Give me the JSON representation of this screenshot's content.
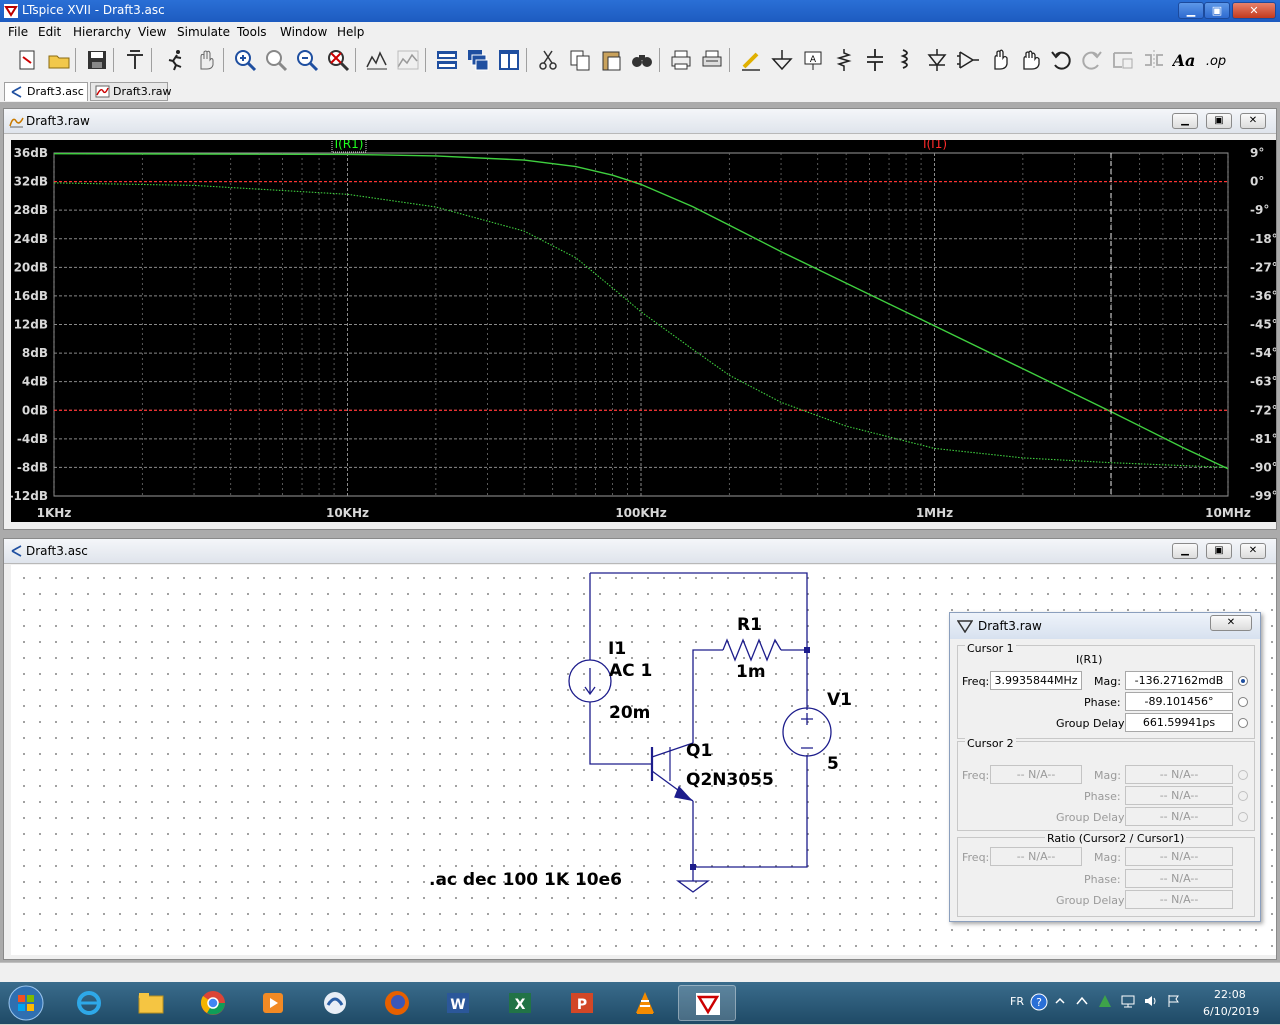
{
  "app": {
    "title": "LTspice XVII - Draft3.asc"
  },
  "menu": [
    "File",
    "Edit",
    "Hierarchy",
    "View",
    "Simulate",
    "Tools",
    "Window",
    "Help"
  ],
  "toolbar_icons": [
    "new-schematic-icon",
    "open-icon",
    "save-icon",
    "control-panel-icon",
    "run-icon",
    "halt-icon",
    "zoom-in-icon",
    "zoom-pan-icon",
    "zoom-out-icon",
    "zoom-fit-icon",
    "autorange-icon",
    "fft-icon",
    "tile-horizontal-icon",
    "cascade-icon",
    "tile-vertical-icon",
    "cut-icon",
    "copy-icon",
    "paste-icon",
    "find-icon",
    "print-icon",
    "print-setup-icon",
    "draw-wire-icon",
    "ground-icon",
    "label-net-icon",
    "resistor-icon",
    "capacitor-icon",
    "inductor-icon",
    "diode-icon",
    "component-icon",
    "move-icon",
    "drag-icon",
    "undo-icon",
    "redo-icon",
    "rotate-icon",
    "mirror-icon",
    "text-icon",
    "spice-directive-icon"
  ],
  "tabs": [
    {
      "label": "Draft3.asc"
    },
    {
      "label": "Draft3.raw"
    }
  ],
  "plot_window": {
    "title": "Draft3.raw"
  },
  "schematic_window": {
    "title": "Draft3.asc"
  },
  "chart_data": {
    "type": "line",
    "x_scale": "log",
    "x_ticks": [
      {
        "v": 1000,
        "label": "1KHz"
      },
      {
        "v": 10000,
        "label": "10KHz"
      },
      {
        "v": 100000,
        "label": "100KHz"
      },
      {
        "v": 1000000,
        "label": "1MHz"
      },
      {
        "v": 10000000,
        "label": "10MHz"
      }
    ],
    "xlim": [
      1000,
      10000000
    ],
    "y_ticks": [
      "36dB",
      "32dB",
      "28dB",
      "24dB",
      "20dB",
      "16dB",
      "12dB",
      "8dB",
      "4dB",
      "0dB",
      "-4dB",
      "-8dB",
      "-12dB"
    ],
    "ylim": [
      -12,
      36
    ],
    "y2_ticks": [
      "9°",
      "0°",
      "-9°",
      "-18°",
      "-27°",
      "-36°",
      "-45°",
      "-54°",
      "-63°",
      "-72°",
      "-81°",
      "-90°",
      "-99°"
    ],
    "y2lim": [
      -99,
      9
    ],
    "grid": true,
    "legend": [
      {
        "name": "I(R1)",
        "color": "#00ff00"
      },
      {
        "name": "I(I1)",
        "color": "#ff0000"
      }
    ],
    "series": [
      {
        "name": "I(R1) magnitude",
        "color": "#3fcf3f",
        "axis": "left",
        "style": "solid",
        "x": [
          1000,
          10000,
          20000,
          40000,
          60000,
          80000,
          100000,
          150000,
          200000,
          300000,
          500000,
          1000000,
          2000000,
          4000000,
          7000000,
          10000000
        ],
        "y": [
          35.9,
          35.8,
          35.6,
          35.0,
          34.1,
          32.9,
          31.6,
          28.5,
          25.9,
          22.2,
          17.8,
          11.8,
          5.8,
          -0.2,
          -5.2,
          -8.2
        ]
      },
      {
        "name": "I(R1) phase",
        "color": "#3fcf3f",
        "axis": "right",
        "style": "dotted",
        "x": [
          1000,
          3000,
          10000,
          20000,
          40000,
          60000,
          80000,
          100000,
          150000,
          200000,
          300000,
          500000,
          1000000,
          2000000,
          4000000,
          10000000
        ],
        "y": [
          -0.4,
          -1.2,
          -4.0,
          -8.0,
          -15.6,
          -24.0,
          -33.5,
          -41.0,
          -52.8,
          -61.0,
          -69.5,
          -77.0,
          -84.0,
          -87.0,
          -88.5,
          -90.0
        ]
      },
      {
        "name": "I(I1) magnitude",
        "color": "#ff3030",
        "axis": "left",
        "style": "dashed",
        "x": [
          1000,
          10000000
        ],
        "y": [
          0,
          0
        ]
      },
      {
        "name": "I(I1) phase",
        "color": "#ff3030",
        "axis": "right",
        "style": "dashed",
        "x": [
          1000,
          10000000
        ],
        "y": [
          0,
          0
        ]
      }
    ],
    "cursor_x": 3993584.4
  },
  "schematic": {
    "i1_name": "I1",
    "i1_value": "AC 1",
    "i1_dc": "20m",
    "r1_name": "R1",
    "r1_value": "1m",
    "v1_name": "V1",
    "v1_value": "5",
    "q1_name": "Q1",
    "q1_model": "Q2N3055",
    "directive": ".ac dec 100 1K 10e6"
  },
  "cursor_dialog": {
    "title": "Draft3.raw",
    "cursor1_label": "Cursor 1",
    "trace": "I(R1)",
    "freq_label": "Freq:",
    "freq": "3.9935844MHz",
    "mag_label": "Mag:",
    "mag": "-136.27162mdB",
    "phase_label": "Phase:",
    "phase": "-89.101456°",
    "gd_label": "Group Delay:",
    "gd": "661.59941ps",
    "cursor2_label": "Cursor 2",
    "na": "-- N/A--",
    "ratio_label": "Ratio (Cursor2 / Cursor1)"
  },
  "tray": {
    "lang": "FR",
    "time": "22:08",
    "date": "6/10/2019"
  }
}
